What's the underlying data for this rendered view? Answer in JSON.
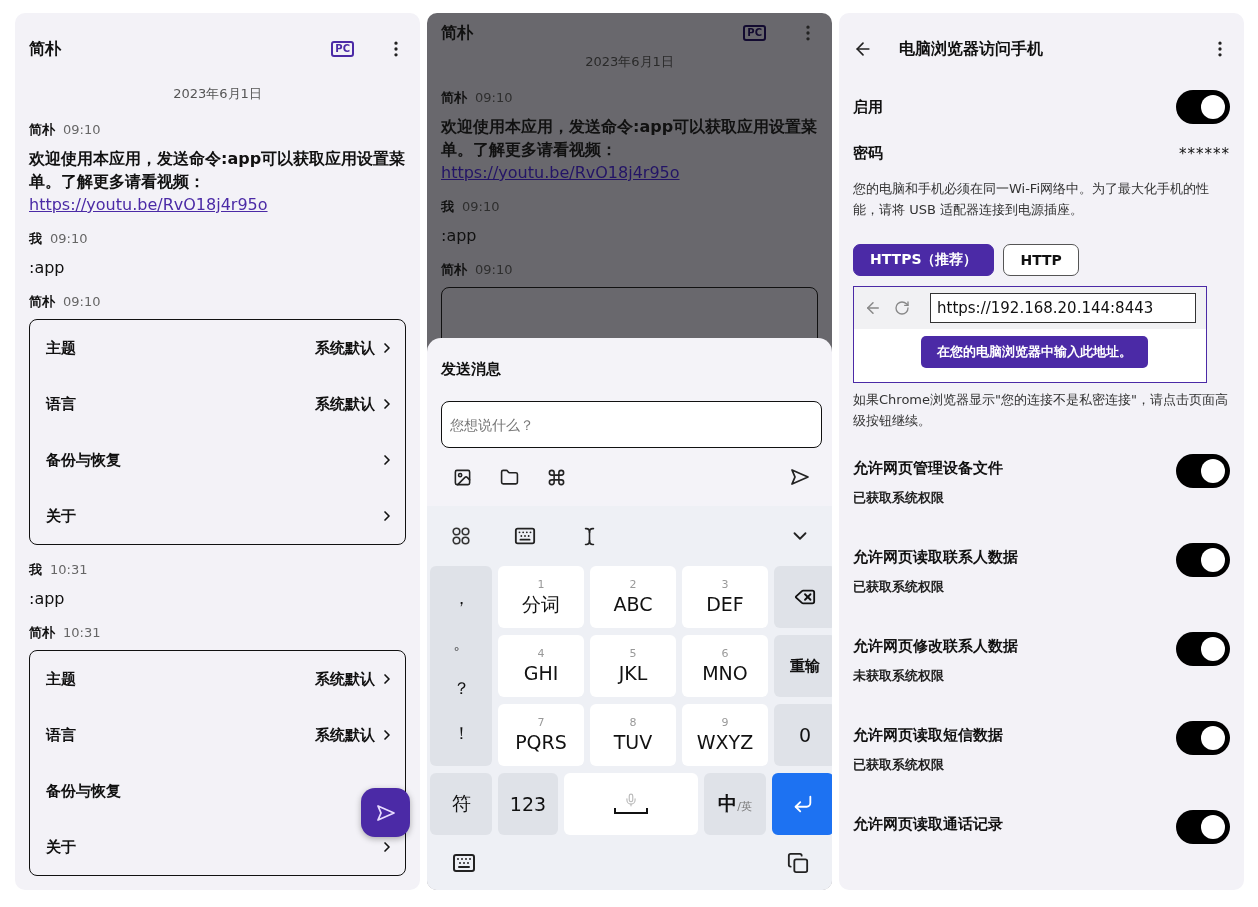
{
  "chat_screen": {
    "title": "简朴",
    "pc_badge": "PC",
    "date": "2023年6月1日",
    "messages": [
      {
        "kind": "text",
        "sender": "简朴",
        "time": "09:10",
        "text": "欢迎使用本应用，发送命令:app可以获取应用设置菜单。了解更多请看视频：",
        "link": "https://youtu.be/RvO18j4r95o",
        "bold": true
      },
      {
        "kind": "text",
        "sender": "我",
        "time": "09:10",
        "text": ":app",
        "bold": false
      },
      {
        "kind": "menu",
        "sender": "简朴",
        "time": "09:10",
        "items": [
          {
            "label": "主题",
            "value": "系统默认",
            "chevron": true
          },
          {
            "label": "语言",
            "value": "系统默认",
            "chevron": true
          },
          {
            "label": "备份与恢复",
            "chevron": true
          },
          {
            "label": "关于",
            "chevron": true
          }
        ]
      },
      {
        "kind": "text",
        "sender": "我",
        "time": "10:31",
        "text": ":app",
        "bold": false
      },
      {
        "kind": "menu",
        "sender": "简朴",
        "time": "10:31",
        "items": [
          {
            "label": "主题",
            "value": "系统默认",
            "chevron": true
          },
          {
            "label": "语言",
            "value": "系统默认",
            "chevron": true
          },
          {
            "label": "备份与恢复",
            "chevron": false
          },
          {
            "label": "关于",
            "chevron": true
          }
        ]
      }
    ]
  },
  "compose_screen": {
    "title": "简朴",
    "pc_badge": "PC",
    "date": "2023年6月1日",
    "messages": [
      {
        "kind": "text",
        "sender": "简朴",
        "time": "09:10",
        "text": "欢迎使用本应用，发送命令:app可以获取应用设置菜单。了解更多请看视频：",
        "link": "https://youtu.be/RvO18j4r95o",
        "bold": true
      },
      {
        "kind": "text",
        "sender": "我",
        "time": "09:10",
        "text": ":app",
        "bold": false
      },
      {
        "kind": "menu",
        "sender": "简朴",
        "time": "09:10"
      }
    ],
    "sheet": {
      "title": "发送消息",
      "placeholder": "您想说什么？"
    },
    "keyboard": {
      "punctuation": [
        "，",
        "。",
        "？",
        "！"
      ],
      "keys": [
        {
          "digit": "1",
          "label": "分词"
        },
        {
          "digit": "2",
          "label": "ABC"
        },
        {
          "digit": "3",
          "label": "DEF"
        },
        {
          "digit": "4",
          "label": "GHI"
        },
        {
          "digit": "5",
          "label": "JKL"
        },
        {
          "digit": "6",
          "label": "MNO"
        },
        {
          "digit": "7",
          "label": "PQRS"
        },
        {
          "digit": "8",
          "label": "TUV"
        },
        {
          "digit": "9",
          "label": "WXYZ"
        }
      ],
      "side_keys": [
        {
          "kind": "backspace"
        },
        {
          "kind": "text",
          "label": "重输"
        },
        {
          "kind": "text",
          "label": "0"
        }
      ],
      "bottom_keys": [
        {
          "kind": "text",
          "label": "符"
        },
        {
          "kind": "text",
          "label": "123"
        },
        {
          "kind": "space"
        },
        {
          "kind": "lang",
          "label": "中",
          "sub": "/英"
        },
        {
          "kind": "enter"
        }
      ]
    }
  },
  "settings_screen": {
    "title": "电脑浏览器访问手机",
    "enable": {
      "label": "启用",
      "on": true
    },
    "password": {
      "label": "密码",
      "value": "******"
    },
    "note": "您的电脑和手机必须在同一Wi-Fi网络中。为了最大化手机的性能，请将 USB 适配器连接到电源插座。",
    "protocols": [
      {
        "label": "HTTPS（推荐）",
        "selected": true
      },
      {
        "label": "HTTP",
        "selected": false
      }
    ],
    "browser_demo": {
      "url": "https://192.168.20.144:8443",
      "tooltip": "在您的电脑浏览器中输入此地址。"
    },
    "warning": "如果Chrome浏览器显示\"您的连接不是私密连接\"，请点击页面高级按钮继续。",
    "permissions": [
      {
        "label": "允许网页管理设备文件",
        "status": "已获取系统权限",
        "on": true
      },
      {
        "label": "允许网页读取联系人数据",
        "status": "已获取系统权限",
        "on": true
      },
      {
        "label": "允许网页修改联系人数据",
        "status": "未获取系统权限",
        "on": true
      },
      {
        "label": "允许网页读取短信数据",
        "status": "已获取系统权限",
        "on": true
      },
      {
        "label": "允许网页读取通话记录",
        "on": true
      }
    ]
  }
}
